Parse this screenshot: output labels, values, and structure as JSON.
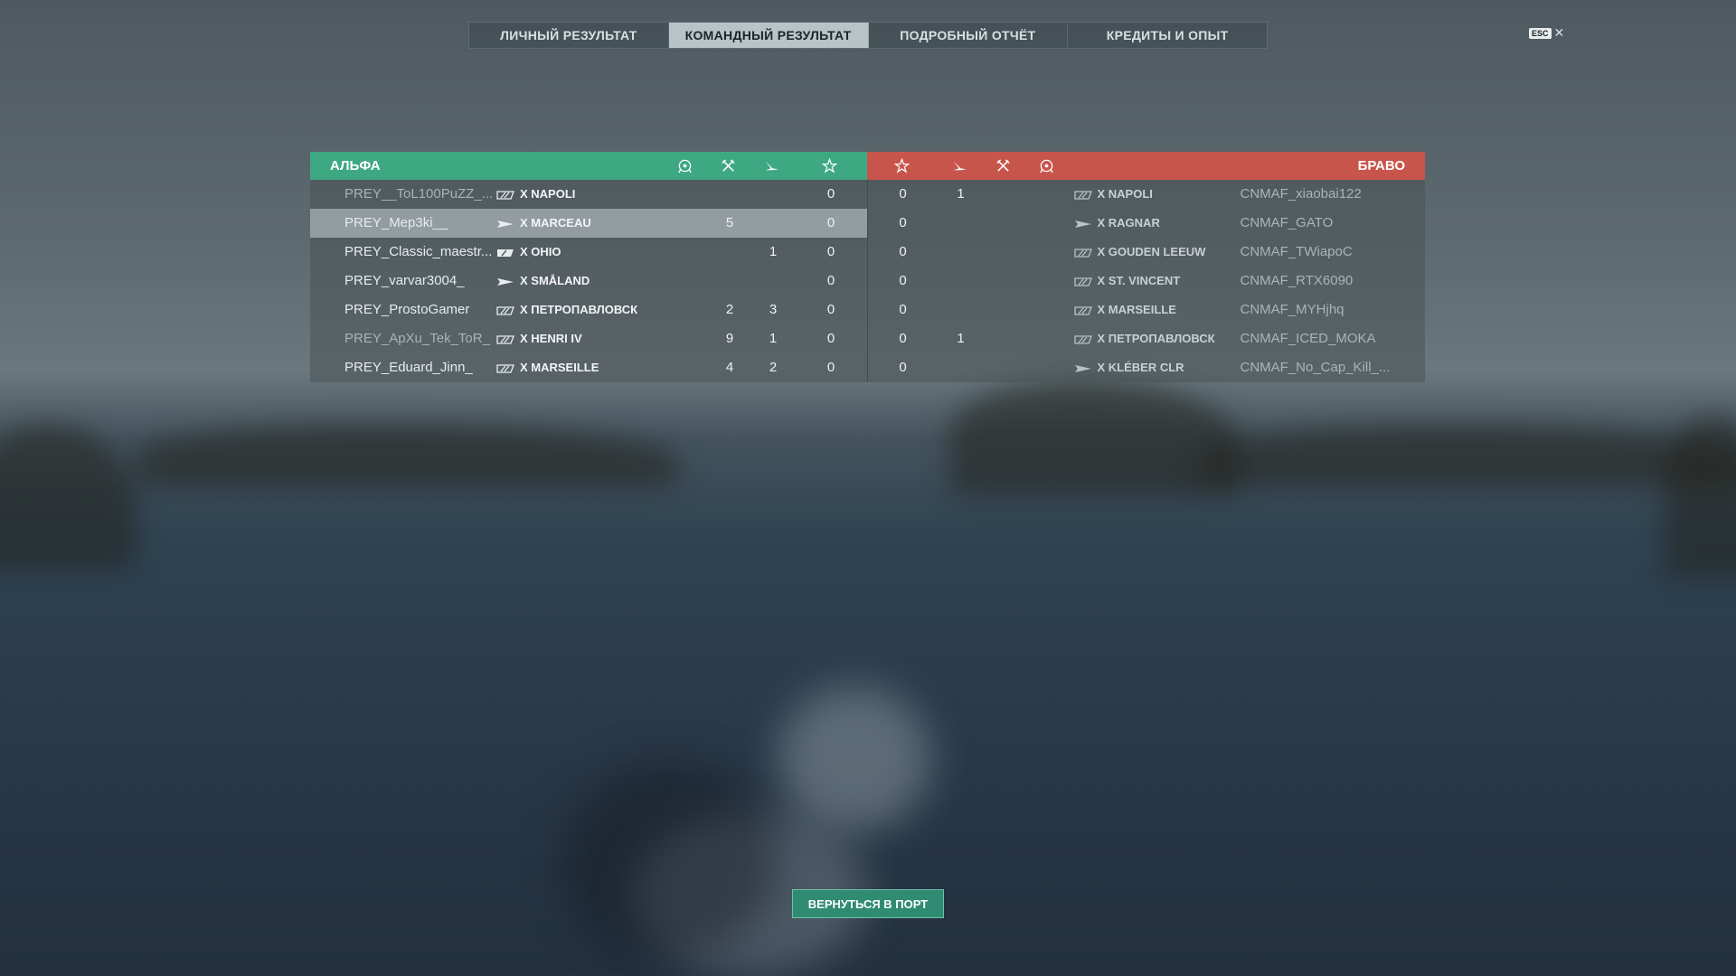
{
  "tabs": [
    {
      "label": "ЛИЧНЫЙ РЕЗУЛЬТАТ",
      "active": false
    },
    {
      "label": "КОМАНДНЫЙ РЕЗУЛЬТАТ",
      "active": true
    },
    {
      "label": "ПОДРОБНЫЙ ОТЧЁТ",
      "active": false
    },
    {
      "label": "КРЕДИТЫ И ОПЫТ",
      "active": false
    }
  ],
  "esc": {
    "key": "ESC",
    "close": "✕"
  },
  "teams": {
    "left": {
      "name": "АЛЬФА",
      "color": "#3ea883"
    },
    "right": {
      "name": "БРАВО",
      "color": "#c8554c"
    }
  },
  "column_icons": [
    "ribbon-icon",
    "kill-icon",
    "plane-icon",
    "base-capture-star-icon"
  ],
  "left_rows": [
    {
      "player": "PREY__ToL100PuZZ_...",
      "ship": "X  NAPOLI",
      "ship_class": "cruiser",
      "dmg": "",
      "kills": "",
      "planes": "",
      "base": "0"
    },
    {
      "player": "PREY_Mep3ki__",
      "ship": "X  MARCEAU",
      "ship_class": "destroyer",
      "dmg": "",
      "kills": "5",
      "planes": "",
      "base": "0"
    },
    {
      "player": "PREY_Classic_maestr...",
      "ship": "X  OHIO",
      "ship_class": "battleship",
      "dmg": "",
      "kills": "",
      "planes": "1",
      "base": "0"
    },
    {
      "player": "PREY_varvar3004_",
      "ship": "X  SMÅLAND",
      "ship_class": "destroyer",
      "dmg": "",
      "kills": "",
      "planes": "",
      "base": "0"
    },
    {
      "player": "PREY_ProstoGamer",
      "ship": "X  ПЕТРОПАВЛОВСК",
      "ship_class": "cruiser",
      "dmg": "",
      "kills": "2",
      "planes": "3",
      "base": "0"
    },
    {
      "player": "PREY_ApXu_Tek_ToR_",
      "ship": "X  HENRI IV",
      "ship_class": "cruiser",
      "dmg": "",
      "kills": "9",
      "planes": "1",
      "base": "0"
    },
    {
      "player": "PREY_Eduard_Jinn_",
      "ship": "X  MARSEILLE",
      "ship_class": "cruiser",
      "dmg": "",
      "kills": "4",
      "planes": "2",
      "base": "0"
    }
  ],
  "right_rows": [
    {
      "base": "0",
      "planes": "1",
      "kills": "",
      "ship": "X  NAPOLI",
      "ship_class": "cruiser",
      "player": "CNMAF_xiaobai122"
    },
    {
      "base": "0",
      "planes": "",
      "kills": "",
      "ship": "X  RAGNAR",
      "ship_class": "destroyer",
      "player": "CNMAF_GATO"
    },
    {
      "base": "0",
      "planes": "",
      "kills": "",
      "ship": "X  GOUDEN LEEUW",
      "ship_class": "cruiser",
      "player": "CNMAF_TWiapoC"
    },
    {
      "base": "0",
      "planes": "",
      "kills": "",
      "ship": "X  ST. VINCENT",
      "ship_class": "cruiser",
      "player": "CNMAF_RTX6090"
    },
    {
      "base": "0",
      "planes": "",
      "kills": "",
      "ship": "X  MARSEILLE",
      "ship_class": "cruiser",
      "player": "CNMAF_MYHjhq"
    },
    {
      "base": "0",
      "planes": "1",
      "kills": "",
      "ship": "X  ПЕТРОПАВЛОВСК",
      "ship_class": "cruiser",
      "player": "CNMAF_ICED_MOKA"
    },
    {
      "base": "0",
      "planes": "",
      "kills": "",
      "ship": "X  KLÉBER CLR",
      "ship_class": "destroyer",
      "player": "CNMAF_No_Cap_Kill_..."
    }
  ],
  "return_button": "ВЕРНУТЬСЯ В ПОРТ"
}
